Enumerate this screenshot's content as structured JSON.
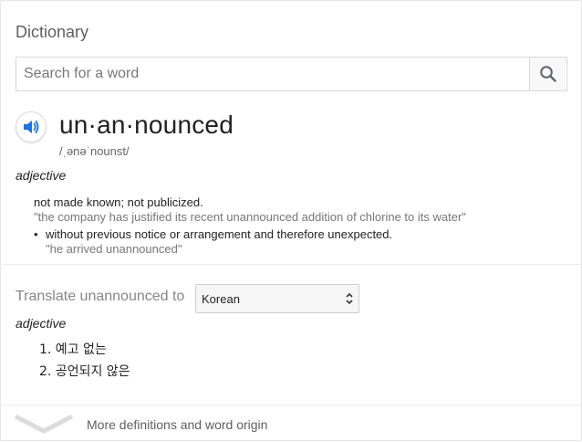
{
  "card": {
    "title": "Dictionary"
  },
  "search": {
    "placeholder": "Search for a word",
    "value": ""
  },
  "entry": {
    "headword": "un·an·nounced",
    "phonetic": "/ˌənəˈnounst/",
    "part_of_speech": "adjective",
    "definitions": [
      {
        "text": "not made known; not publicized.",
        "example": "\"the company has justified its recent unannounced addition of chlorine to its water\""
      },
      {
        "text": "without previous notice or arrangement and therefore unexpected.",
        "example": "\"he arrived unannounced\""
      }
    ]
  },
  "translate": {
    "label": "Translate unannounced to",
    "language": "Korean",
    "part_of_speech": "adjective",
    "items": [
      "1. 예고 없는",
      "2. 공언되지 않은"
    ]
  },
  "footer": {
    "more_label": "More definitions and word origin"
  },
  "colors": {
    "accent": "#4285f4",
    "muted_text": "#777777",
    "divider": "#ececec"
  }
}
